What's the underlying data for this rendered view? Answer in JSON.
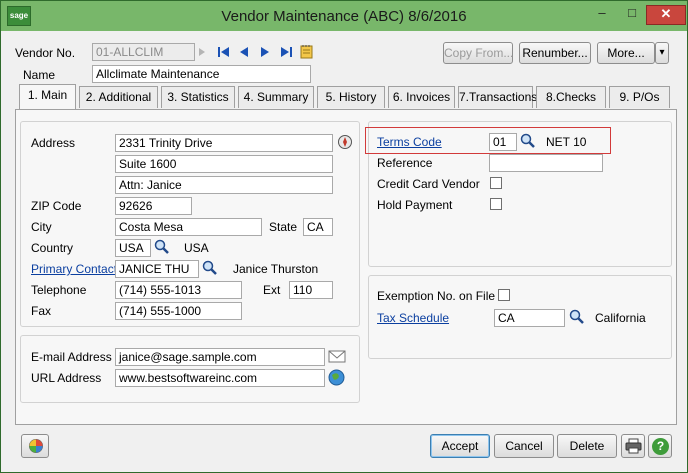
{
  "window": {
    "title": "Vendor Maintenance (ABC) 8/6/2016",
    "logo": "sage",
    "minimize": "–",
    "maximize": "□",
    "close": "✕"
  },
  "header": {
    "vendor_no_label": "Vendor No.",
    "vendor_no_value": "01-ALLCLIM",
    "name_label": "Name",
    "name_value": "Allclimate Maintenance",
    "copy_from": "Copy From...",
    "renumber": "Renumber...",
    "more": "More...",
    "more_arrow": "▾"
  },
  "tabs": [
    {
      "label": "1. Main"
    },
    {
      "label": "2. Additional"
    },
    {
      "label": "3. Statistics"
    },
    {
      "label": "4. Summary"
    },
    {
      "label": "5. History"
    },
    {
      "label": "6. Invoices"
    },
    {
      "label": "7.Transactions"
    },
    {
      "label": "8.Checks"
    },
    {
      "label": "9. P/Os"
    }
  ],
  "address": {
    "address_label": "Address",
    "line1": "2331 Trinity Drive",
    "line2": "Suite 1600",
    "line3": "Attn: Janice",
    "zip_label": "ZIP Code",
    "zip": "92626",
    "city_label": "City",
    "city": "Costa Mesa",
    "state_label": "State",
    "state": "CA",
    "country_label": "Country",
    "country": "USA",
    "country_desc": "USA",
    "contact_label": "Primary Contact",
    "contact": "JANICE THU",
    "contact_desc": "Janice Thurston",
    "telephone_label": "Telephone",
    "telephone": "(714) 555-1013",
    "ext_label": "Ext",
    "ext": "110",
    "fax_label": "Fax",
    "fax": "(714) 555-1000"
  },
  "web": {
    "email_label": "E-mail Address",
    "email": "janice@sage.sample.com",
    "url_label": "URL Address",
    "url": "www.bestsoftwareinc.com"
  },
  "terms": {
    "terms_label": "Terms Code",
    "terms": "01",
    "terms_desc": "NET 10",
    "reference_label": "Reference",
    "reference": "",
    "credit_card_label": "Credit Card Vendor",
    "credit_card_checked": false,
    "hold_label": "Hold Payment",
    "hold_checked": false
  },
  "tax": {
    "exemption_label": "Exemption No. on File",
    "exemption_checked": false,
    "schedule_label": "Tax Schedule",
    "schedule": "CA",
    "schedule_desc": "California"
  },
  "footer": {
    "accept": "Accept",
    "cancel": "Cancel",
    "delete": "Delete",
    "help": "?"
  },
  "colors": {
    "title_bar": "#78b76a",
    "link": "#0b3fa0",
    "highlight": "#d23a3a",
    "close": "#c9463d"
  }
}
